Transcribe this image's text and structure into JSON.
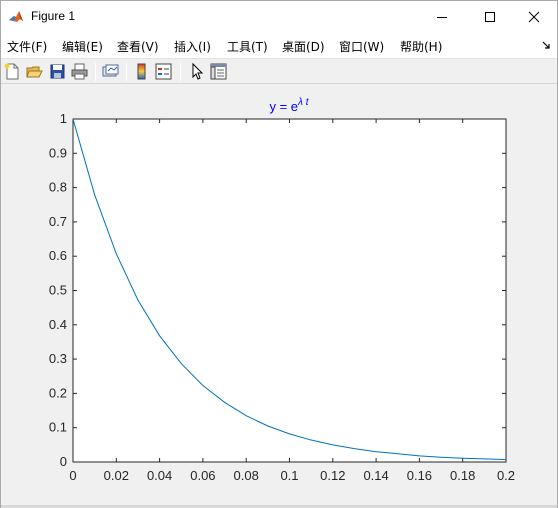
{
  "window": {
    "title": "Figure 1"
  },
  "menu": {
    "items": [
      {
        "label": "文件(F)"
      },
      {
        "label": "编辑(E)"
      },
      {
        "label": "查看(V)"
      },
      {
        "label": "插入(I)"
      },
      {
        "label": "工具(T)"
      },
      {
        "label": "桌面(D)"
      },
      {
        "label": "窗口(W)"
      },
      {
        "label": "帮助(H)"
      }
    ]
  },
  "toolbar": {
    "icons": [
      "new-figure-icon",
      "open-file-icon",
      "save-icon",
      "print-icon",
      "link-plot-icon",
      "colorbar-icon",
      "legend-icon",
      "pointer-icon",
      "property-inspector-icon"
    ]
  },
  "colors": {
    "line": "#0072BD",
    "title": "#0000ff",
    "axes_bg": "#ffffff",
    "figure_bg": "#f0f0f0"
  },
  "chart_data": {
    "type": "line",
    "title": "y = e^{λ t}",
    "title_parts": {
      "base": "y = e",
      "exponent": "λ t"
    },
    "xlabel": "",
    "ylabel": "",
    "xlim": [
      0,
      0.2
    ],
    "ylim": [
      0,
      1
    ],
    "xticks": [
      "0",
      "0.02",
      "0.04",
      "0.06",
      "0.08",
      "0.1",
      "0.12",
      "0.14",
      "0.16",
      "0.18",
      "0.2"
    ],
    "yticks": [
      "0",
      "0.1",
      "0.2",
      "0.3",
      "0.4",
      "0.5",
      "0.6",
      "0.7",
      "0.8",
      "0.9",
      "1"
    ],
    "grid": false,
    "series": [
      {
        "x": [
          0,
          0.01,
          0.02,
          0.03,
          0.04,
          0.05,
          0.06,
          0.07,
          0.08,
          0.09,
          0.1,
          0.11,
          0.12,
          0.13,
          0.14,
          0.15,
          0.16,
          0.17,
          0.18,
          0.19,
          0.2
        ],
        "y": [
          1.0,
          0.779,
          0.607,
          0.472,
          0.368,
          0.287,
          0.223,
          0.174,
          0.135,
          0.105,
          0.082,
          0.064,
          0.05,
          0.039,
          0.03,
          0.024,
          0.018,
          0.014,
          0.011,
          0.009,
          0.007
        ]
      }
    ]
  }
}
